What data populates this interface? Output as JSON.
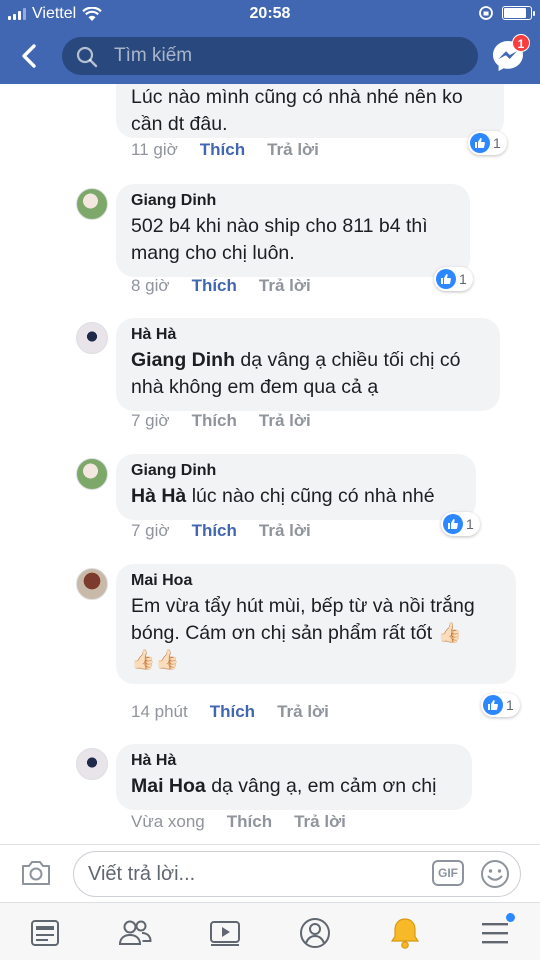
{
  "status_bar": {
    "carrier": "Viettel",
    "time": "20:58",
    "battery_level": 0.92
  },
  "nav": {
    "search_placeholder": "Tìm kiếm",
    "messenger_badge": "1"
  },
  "comments": [
    {
      "author": "",
      "mention": "",
      "text": "Lúc nào mình cũng có nhà nhé nên ko cần dt đâu.",
      "time": "11 giờ",
      "like_label": "Thích",
      "liked": true,
      "reply_label": "Trả lời",
      "reactions": "1"
    },
    {
      "author": "Giang Dinh",
      "mention": "",
      "text": "502 b4 khi nào ship cho 811 b4 thì mang cho chị luôn.",
      "time": "8 giờ",
      "like_label": "Thích",
      "liked": true,
      "reply_label": "Trả lời",
      "reactions": "1"
    },
    {
      "author": "Hà Hà",
      "mention": "Giang Dinh",
      "text": "dạ vâng ạ chiều tối chị có nhà không em đem qua cả ạ",
      "time": "7 giờ",
      "like_label": "Thích",
      "liked": false,
      "reply_label": "Trả lời",
      "reactions": ""
    },
    {
      "author": "Giang Dinh",
      "mention": "Hà Hà",
      "text": "lúc nào chị cũng có nhà nhé",
      "time": "7 giờ",
      "like_label": "Thích",
      "liked": true,
      "reply_label": "Trả lời",
      "reactions": "1"
    },
    {
      "author": "Mai Hoa",
      "mention": "",
      "text": "Em vừa tẩy hút mùi, bếp từ và nồi trắng bóng. Cám ơn chị sản phẩm rất tốt 👍🏻",
      "text_line3": "👍🏻👍🏻",
      "time": "14 phút",
      "like_label": "Thích",
      "liked": true,
      "reply_label": "Trả lời",
      "reactions": "1"
    },
    {
      "author": "Hà Hà",
      "mention": "Mai Hoa",
      "text": "dạ vâng ạ, em cảm ơn chị",
      "time": "Vừa xong",
      "like_label": "Thích",
      "liked": false,
      "reply_label": "Trả lời",
      "reactions": ""
    }
  ],
  "composer": {
    "placeholder": "Viết trả lời...",
    "gif_label": "GIF"
  },
  "tabbar": {
    "tabs": [
      "news-feed",
      "friends",
      "watch",
      "profile",
      "notifications",
      "menu"
    ],
    "active": "notifications"
  },
  "colors": {
    "brand": "#4267b2",
    "like_blue": "#4267b2",
    "reaction_blue": "#2d88ff",
    "bubble": "#f2f3f5",
    "muted": "#90949c",
    "bell_active": "#f7b928"
  }
}
